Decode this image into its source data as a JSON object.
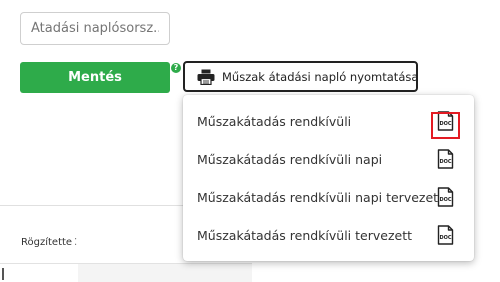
{
  "form": {
    "search_placeholder": "Átadási naplósorsz...",
    "save_label": "Mentés",
    "help_symbol": "?",
    "print_label": "Műszak átadási napló nyomtatása"
  },
  "table": {
    "recorded_by_header": "Rögzítette",
    "sort_symbol": "⁚"
  },
  "menu": {
    "items": [
      {
        "label": "Műszakátadás rendkívüli",
        "icon": "doc-icon",
        "highlighted": true
      },
      {
        "label": "Műszakátadás rendkívüli napi",
        "icon": "doc-icon",
        "highlighted": false
      },
      {
        "label": "Műszakátadás rendkívüli napi tervezett",
        "icon": "doc-icon",
        "highlighted": false
      },
      {
        "label": "Műszakátadás rendkívüli tervezett",
        "icon": "doc-icon",
        "highlighted": false
      }
    ],
    "icon_text": "DOC"
  },
  "colors": {
    "save_green": "#2eab4a",
    "highlight_red": "#e31b23",
    "border_dark": "#222222"
  }
}
